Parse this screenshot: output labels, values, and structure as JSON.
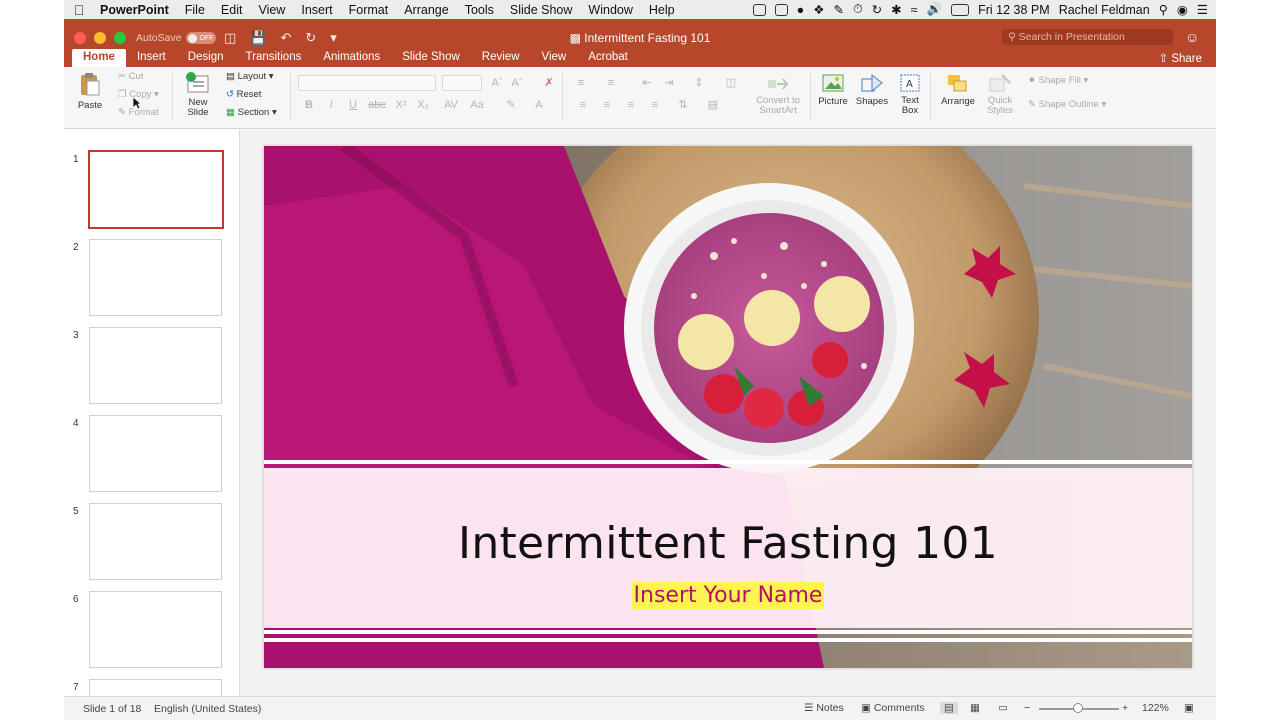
{
  "menubar": {
    "app_name": "PowerPoint",
    "items": [
      "File",
      "Edit",
      "View",
      "Insert",
      "Format",
      "Arrange",
      "Tools",
      "Slide Show",
      "Window",
      "Help"
    ],
    "clock": "Fri 12 38 PM",
    "user": "Rachel Feldman"
  },
  "window": {
    "autosave_label": "AutoSave",
    "autosave_state": "OFF",
    "doc_title": "Intermittent Fasting 101",
    "search_placeholder": "Search in Presentation",
    "accent_color": "#b7472a"
  },
  "ribbon": {
    "tabs": [
      "Home",
      "Insert",
      "Design",
      "Transitions",
      "Animations",
      "Slide Show",
      "Review",
      "View",
      "Acrobat"
    ],
    "active_tab": "Home",
    "share_label": "Share",
    "clipboard": {
      "paste": "Paste",
      "cut": "Cut",
      "copy": "Copy",
      "format": "Format"
    },
    "slides": {
      "new_slide_line1": "New",
      "new_slide_line2": "Slide",
      "layout": "Layout",
      "reset": "Reset",
      "section": "Section"
    },
    "convert_line1": "Convert to",
    "convert_line2": "SmartArt",
    "picture": "Picture",
    "shapes": "Shapes",
    "textbox_line1": "Text",
    "textbox_line2": "Box",
    "arrange": "Arrange",
    "quick_styles_line1": "Quick",
    "quick_styles_line2": "Styles",
    "shape_fill": "Shape Fill",
    "shape_outline": "Shape Outline"
  },
  "thumbnails": {
    "numbers": [
      "1",
      "2",
      "3",
      "4",
      "5",
      "6",
      "7"
    ],
    "selected": "1"
  },
  "slide": {
    "title": "Intermittent Fasting 101",
    "subtitle": "Insert Your Name",
    "accent_magenta": "#b1106e",
    "highlight_color": "#fff44f"
  },
  "status": {
    "slide_info": "Slide 1 of 18",
    "language": "English (United States)",
    "notes": "Notes",
    "comments": "Comments",
    "zoom": "122%"
  }
}
